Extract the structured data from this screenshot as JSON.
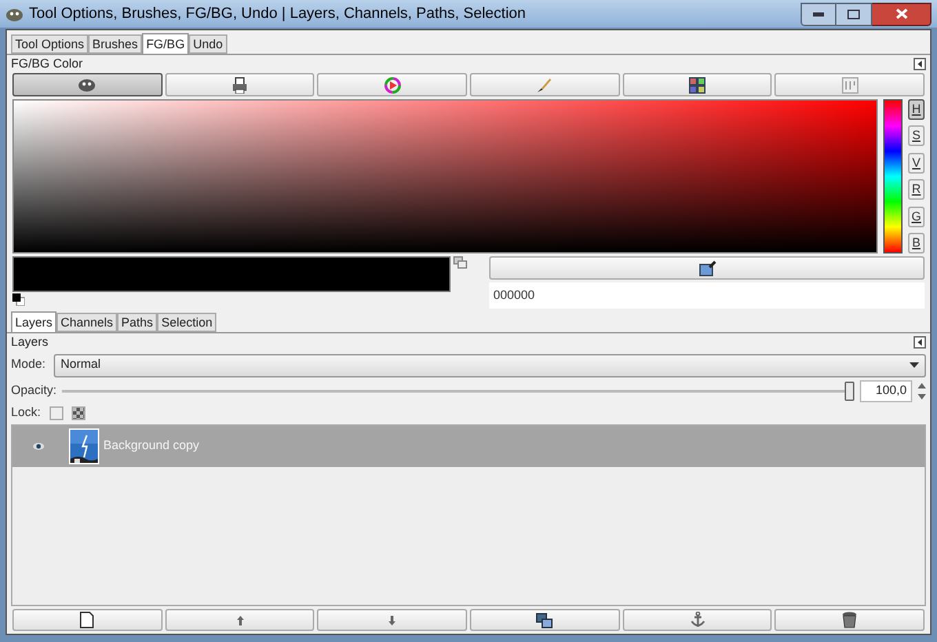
{
  "window": {
    "title": "Tool Options, Brushes, FG/BG, Undo | Layers, Channels, Paths, Selection"
  },
  "top_tabs": [
    {
      "label": "Tool Options",
      "selected": false
    },
    {
      "label": "Brushes",
      "selected": false
    },
    {
      "label": "FG/BG",
      "selected": true
    },
    {
      "label": "Undo",
      "selected": false
    }
  ],
  "fgbg": {
    "title": "FG/BG Color",
    "selectors": [
      {
        "kind": "gimp",
        "selected": true
      },
      {
        "kind": "cmyk",
        "selected": false
      },
      {
        "kind": "wheel",
        "selected": false
      },
      {
        "kind": "watercolor",
        "selected": false
      },
      {
        "kind": "scales",
        "selected": false
      },
      {
        "kind": "palette",
        "selected": false
      }
    ],
    "channels": [
      {
        "label": "H",
        "selected": true
      },
      {
        "label": "S",
        "selected": false
      },
      {
        "label": "V",
        "selected": false
      },
      {
        "label": "R",
        "selected": false
      },
      {
        "label": "G",
        "selected": false
      },
      {
        "label": "B",
        "selected": false
      }
    ],
    "hex": "000000"
  },
  "bottom_tabs": [
    {
      "label": "Layers",
      "selected": true
    },
    {
      "label": "Channels",
      "selected": false
    },
    {
      "label": "Paths",
      "selected": false
    },
    {
      "label": "Selection",
      "selected": false
    }
  ],
  "layers": {
    "title": "Layers",
    "mode_label": "Mode:",
    "mode": "Normal",
    "opacity_label": "Opacity:",
    "opacity": {
      "level": 1,
      "reading": "100,0"
    },
    "lock_label": "Lock:",
    "locks": [
      {
        "kind": "pixels",
        "checked": false
      },
      {
        "kind": "alpha",
        "checked": false
      }
    ],
    "items": [
      {
        "name": "Background copy",
        "visible": true,
        "selected": true
      }
    ]
  },
  "actions": [
    {
      "kind": "new"
    },
    {
      "kind": "raise"
    },
    {
      "kind": "lower"
    },
    {
      "kind": "duplicate"
    },
    {
      "kind": "anchor"
    },
    {
      "kind": "delete"
    }
  ]
}
